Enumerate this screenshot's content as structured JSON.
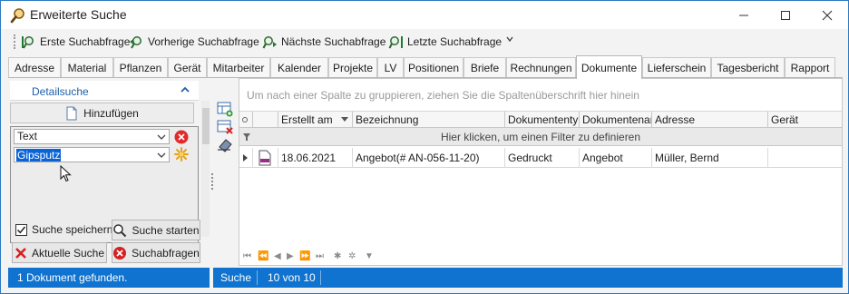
{
  "window": {
    "title": "Erweiterte Suche",
    "accent": "#0f73cf"
  },
  "toolbar": {
    "first": "Erste Suchabfrage",
    "prev": "Vorherige Suchabfrage",
    "next": "Nächste Suchabfrage",
    "last": "Letzte Suchabfrage"
  },
  "tabs": [
    "Adresse",
    "Material",
    "Pflanzen",
    "Gerät",
    "Mitarbeiter",
    "Kalender",
    "Projekte",
    "LV",
    "Positionen",
    "Briefe",
    "Rechnungen",
    "Dokumente",
    "Lieferschein",
    "Tagesbericht",
    "Rapport"
  ],
  "active_tab": "Dokumente",
  "left": {
    "section_title": "Detailsuche",
    "add_label": "Hinzufügen",
    "field": "Text",
    "value": "Gipsputz",
    "save_search_label": "Suche speichern",
    "save_search_checked": true,
    "start_label": "Suche starten",
    "current_label": "Aktuelle Suche",
    "queries_label": "Suchabfragen",
    "status": "1 Dokument gefunden."
  },
  "grid": {
    "group_hint": "Um nach einer Spalte zu gruppieren, ziehen Sie die Spaltenüberschrift hier hinein",
    "columns": [
      "Erstellt am",
      "Bezeichnung",
      "Dokumententyp",
      "Dokumentenart",
      "Adresse",
      "Gerät"
    ],
    "filter_hint": "Hier klicken, um einen Filter zu definieren",
    "rows": [
      {
        "created": "18.06.2021",
        "name": "Angebot(# AN-056-11-20)",
        "doctype": "Gedruckt",
        "docart": "Angebot",
        "address": "Müller, Bernd",
        "device": ""
      }
    ]
  },
  "status_right": {
    "mode": "Suche",
    "count": "10 von 10"
  }
}
